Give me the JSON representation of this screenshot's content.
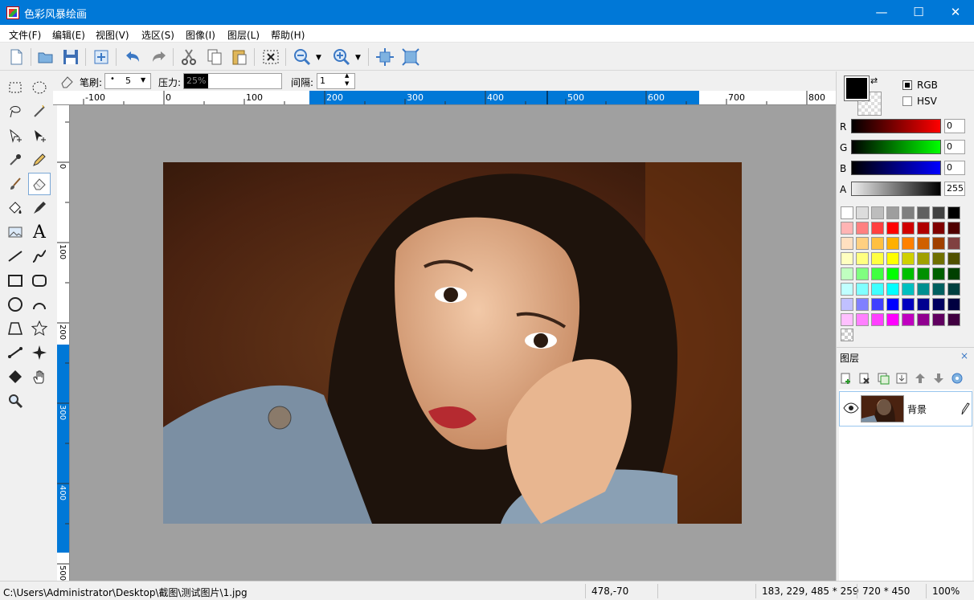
{
  "window": {
    "title": "色彩风暴绘画",
    "minimize": "—",
    "maximize": "☐",
    "close": "✕"
  },
  "menu": [
    "文件(F)",
    "编辑(E)",
    "视图(V)",
    "选区(S)",
    "图像(I)",
    "图层(L)",
    "帮助(H)"
  ],
  "toolbar_icons": [
    "new-file-icon",
    "open-folder-icon",
    "save-icon",
    "resize-icon",
    "undo-icon",
    "redo-icon",
    "cut-icon",
    "copy-icon",
    "paste-icon",
    "deselect-icon",
    "zoom-out-icon",
    "zoom-in-icon",
    "fit-window-icon",
    "actual-size-icon"
  ],
  "options": {
    "brush_label": "笔刷:",
    "brush_size": "5",
    "pressure_label": "压力:",
    "pressure_value": "25%",
    "interval_label": "间隔:",
    "interval_value": "1"
  },
  "tools": [
    "rect-select",
    "ellipse-select",
    "lasso",
    "magic-wand",
    "move-selection",
    "move",
    "eyedropper",
    "pencil",
    "brush",
    "eraser",
    "fill",
    "clone-stamp",
    "image",
    "text",
    "line",
    "curve",
    "rectangle",
    "rounded-rect",
    "ellipse",
    "arc",
    "polygon",
    "star",
    "connector",
    "sharpen",
    "diamond",
    "hand",
    "magnifier"
  ],
  "active_tool": "eraser",
  "ruler": {
    "h_labels": [
      "-100",
      "0",
      "100",
      "200",
      "300",
      "400",
      "500",
      "600",
      "700",
      "800"
    ],
    "v_labels": [
      "0",
      "100",
      "200",
      "300",
      "400",
      "500"
    ],
    "highlight_color": "#0078d7"
  },
  "color": {
    "mode_rgb": "RGB",
    "mode_hsv": "HSV",
    "r_label": "R",
    "g_label": "G",
    "b_label": "B",
    "a_label": "A",
    "r": "0",
    "g": "0",
    "b": "0",
    "a": "255",
    "foreground": "#000000",
    "background": "#ffffff"
  },
  "palette": [
    [
      "#ffffff",
      "#dcdcdc",
      "#bdbdbd",
      "#9e9e9e",
      "#7f7f7f",
      "#606060",
      "#414141",
      "#000000"
    ],
    [
      "#ffb4b4",
      "#ff8080",
      "#ff4040",
      "#ff0000",
      "#d00000",
      "#b00000",
      "#800000",
      "#500000"
    ],
    [
      "#ffe0c0",
      "#ffd080",
      "#ffc040",
      "#ffb000",
      "#ff8000",
      "#d06000",
      "#a04000",
      "#804040"
    ],
    [
      "#ffffc0",
      "#ffff80",
      "#ffff40",
      "#ffff00",
      "#d0d000",
      "#a0a000",
      "#707000",
      "#505000"
    ],
    [
      "#c0ffc0",
      "#80ff80",
      "#40ff40",
      "#00ff00",
      "#00c000",
      "#009000",
      "#006000",
      "#004000"
    ],
    [
      "#c0ffff",
      "#80ffff",
      "#40ffff",
      "#00ffff",
      "#00c0c0",
      "#009090",
      "#006060",
      "#004040"
    ],
    [
      "#c0c0ff",
      "#8080ff",
      "#4040ff",
      "#0000ff",
      "#0000c0",
      "#000090",
      "#000060",
      "#000040"
    ],
    [
      "#ffc0ff",
      "#ff80ff",
      "#ff40ff",
      "#ff00ff",
      "#c000c0",
      "#900090",
      "#600060",
      "#400040"
    ]
  ],
  "layers": {
    "title": "图层",
    "close": "×",
    "items": [
      {
        "name": "背景"
      }
    ]
  },
  "status": {
    "path": "C:\\Users\\Administrator\\Desktop\\截图\\测试图片\\1.jpg",
    "cursor": "478,-70",
    "selection": "183, 229, 485 * 259",
    "size": "720 * 450",
    "zoom": "100%"
  }
}
